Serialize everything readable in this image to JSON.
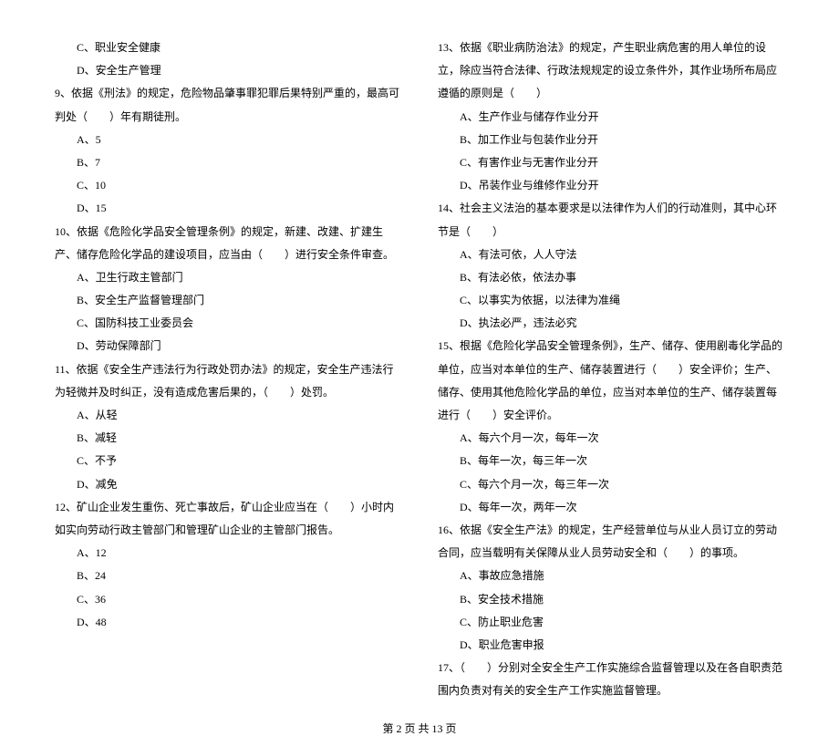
{
  "left": {
    "q8_opt_c": "C、职业安全健康",
    "q8_opt_d": "D、安全生产管理",
    "q9": "9、依据《刑法》的规定，危险物品肇事罪犯罪后果特别严重的，最高可判处（　　）年有期徒刑。",
    "q9_a": "A、5",
    "q9_b": "B、7",
    "q9_c": "C、10",
    "q9_d": "D、15",
    "q10": "10、依据《危险化学品安全管理条例》的规定，新建、改建、扩建生产、储存危险化学品的建设项目，应当由（　　）进行安全条件审查。",
    "q10_a": "A、卫生行政主管部门",
    "q10_b": "B、安全生产监督管理部门",
    "q10_c": "C、国防科技工业委员会",
    "q10_d": "D、劳动保障部门",
    "q11": "11、依据《安全生产违法行为行政处罚办法》的规定，安全生产违法行为轻微并及时纠正，没有造成危害后果的，（　　）处罚。",
    "q11_a": "A、从轻",
    "q11_b": "B、减轻",
    "q11_c": "C、不予",
    "q11_d": "D、减免",
    "q12": "12、矿山企业发生重伤、死亡事故后，矿山企业应当在（　　）小时内如实向劳动行政主管部门和管理矿山企业的主管部门报告。",
    "q12_a": "A、12",
    "q12_b": "B、24",
    "q12_c": "C、36",
    "q12_d": "D、48"
  },
  "right": {
    "q13": "13、依据《职业病防治法》的规定，产生职业病危害的用人单位的设立，除应当符合法律、行政法规规定的设立条件外，其作业场所布局应遵循的原则是（　　）",
    "q13_a": "A、生产作业与储存作业分开",
    "q13_b": "B、加工作业与包装作业分开",
    "q13_c": "C、有害作业与无害作业分开",
    "q13_d": "D、吊装作业与维修作业分开",
    "q14": "14、社会主义法治的基本要求是以法律作为人们的行动准则，其中心环节是（　　）",
    "q14_a": "A、有法可依，人人守法",
    "q14_b": "B、有法必依，依法办事",
    "q14_c": "C、以事实为依据，以法律为准绳",
    "q14_d": "D、执法必严，违法必究",
    "q15": "15、根据《危险化学品安全管理条例》，生产、储存、使用剧毒化学品的单位，应当对本单位的生产、储存装置进行（　　）安全评价；生产、储存、使用其他危险化学品的单位，应当对本单位的生产、储存装置每进行（　　）安全评价。",
    "q15_a": "A、每六个月一次，每年一次",
    "q15_b": "B、每年一次，每三年一次",
    "q15_c": "C、每六个月一次，每三年一次",
    "q15_d": "D、每年一次，两年一次",
    "q16": "16、依据《安全生产法》的规定，生产经营单位与从业人员订立的劳动合同，应当载明有关保障从业人员劳动安全和（　　）的事项。",
    "q16_a": "A、事故应急措施",
    "q16_b": "B、安全技术措施",
    "q16_c": "C、防止职业危害",
    "q16_d": "D、职业危害申报",
    "q17": "17、（　　）分别对全安全生产工作实施综合监督管理以及在各自职责范围内负责对有关的安全生产工作实施监督管理。"
  },
  "footer": "第 2 页 共 13 页"
}
